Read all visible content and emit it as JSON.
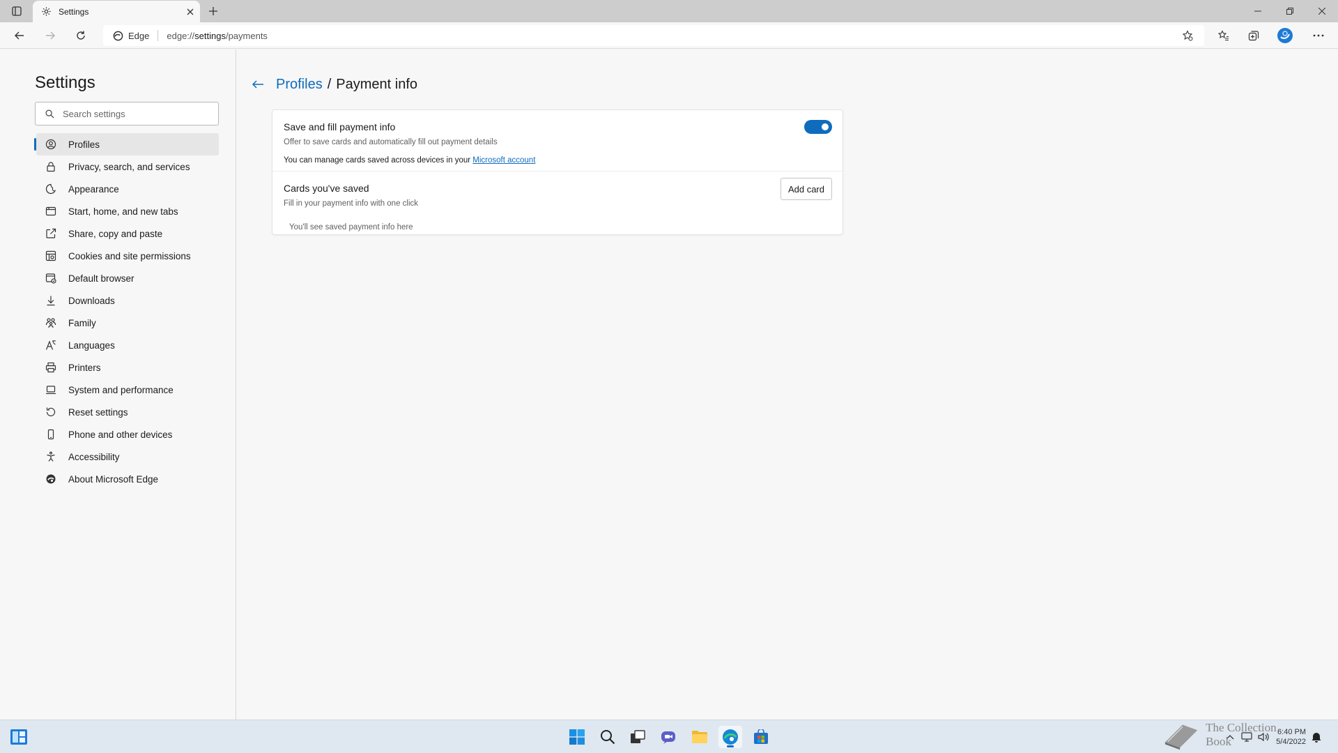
{
  "browser": {
    "tab_title": "Settings",
    "address_chip": "Edge",
    "url_prefix": "edge://",
    "url_highlight": "settings",
    "url_suffix": "/payments"
  },
  "sidebar": {
    "title": "Settings",
    "search_placeholder": "Search settings",
    "items": [
      {
        "label": "Profiles",
        "icon": "profile-icon",
        "active": true
      },
      {
        "label": "Privacy, search, and services",
        "icon": "lock-icon"
      },
      {
        "label": "Appearance",
        "icon": "appearance-icon"
      },
      {
        "label": "Start, home, and new tabs",
        "icon": "home-tabs-icon"
      },
      {
        "label": "Share, copy and paste",
        "icon": "share-icon"
      },
      {
        "label": "Cookies and site permissions",
        "icon": "cookies-icon"
      },
      {
        "label": "Default browser",
        "icon": "default-browser-icon"
      },
      {
        "label": "Downloads",
        "icon": "download-icon"
      },
      {
        "label": "Family",
        "icon": "family-icon"
      },
      {
        "label": "Languages",
        "icon": "languages-icon"
      },
      {
        "label": "Printers",
        "icon": "printer-icon"
      },
      {
        "label": "System and performance",
        "icon": "laptop-icon"
      },
      {
        "label": "Reset settings",
        "icon": "reset-icon"
      },
      {
        "label": "Phone and other devices",
        "icon": "phone-icon"
      },
      {
        "label": "Accessibility",
        "icon": "accessibility-icon"
      },
      {
        "label": "About Microsoft Edge",
        "icon": "edge-logo-icon"
      }
    ]
  },
  "main": {
    "breadcrumb_parent": "Profiles",
    "breadcrumb_separator": "/",
    "page_title": "Payment info",
    "save_fill": {
      "title": "Save and fill payment info",
      "subtitle": "Offer to save cards and automatically fill out payment details",
      "note_prefix": "You can manage cards saved across devices in your ",
      "note_link": "Microsoft account",
      "toggle_on": true
    },
    "cards": {
      "title": "Cards you've saved",
      "subtitle": "Fill in your payment info with one click",
      "add_button": "Add card",
      "empty_text": "You'll see saved payment info here"
    }
  },
  "taskbar": {
    "time": "6:40 PM",
    "date": "5/4/2022",
    "watermark_text": "The Collection Book"
  },
  "colors": {
    "accent": "#0f6cbd",
    "taskbar": "#dfe8f1",
    "titlebar": "#cdcdcd"
  }
}
